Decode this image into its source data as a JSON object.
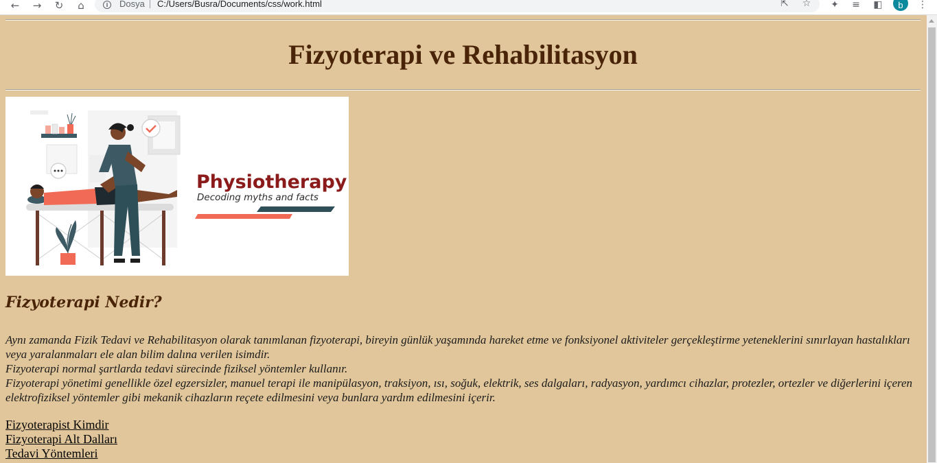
{
  "browser": {
    "scheme_label": "Dosya",
    "url": "C:/Users/Busra/Documents/css/work.html",
    "profile_initial": "b",
    "icons": [
      "back-icon",
      "forward-icon",
      "reload-icon",
      "home-icon",
      "info-icon",
      "share-icon",
      "star-icon",
      "extensions-icon",
      "reading-list-icon",
      "side-panel-icon",
      "menu-icon"
    ]
  },
  "page": {
    "title": "Fizyoterapi ve Rehabilitasyon",
    "hero_image": {
      "heading": "Physiotherapy:",
      "tagline": "Decoding myths and facts"
    },
    "section_heading": "Fizyoterapi Nedir?",
    "paragraph_lines": [
      "Aynı zamanda Fizik Tedavi ve Rehabilitasyon olarak tanımlanan fizyoterapi, bireyin günlük yaşamında hareket etme ve fonksiyonel aktiviteler gerçekleştirme yeteneklerini sınırlayan hastalıkları veya yaralanmaları ele alan bilim dalına verilen isimdir.",
      "Fizyoterapi normal şartlarda tedavi sürecinde fiziksel yöntemler kullanır.",
      "Fizyoterapi yönetimi genellikle özel egzersizler, manuel terapi ile manipülasyon, traksiyon, ısı, soğuk, elektrik, ses dalgaları, radyasyon, yardımcı cihazlar, protezler, ortezler ve diğerlerini içeren elektrofiziksel yöntemler gibi mekanik cihazların reçete edilmesini veya bunlara yardım edilmesini içerir."
    ],
    "links": [
      "Fizyoterapist Kimdir",
      "Fizyoterapi Alt Dalları",
      "Tedavi Yöntemleri"
    ]
  },
  "colors": {
    "background": "#e0c69a",
    "heading": "#4a2408",
    "hero_heading": "#8b1a1a",
    "accent_coral": "#f06a55",
    "accent_teal": "#2f4f58"
  }
}
